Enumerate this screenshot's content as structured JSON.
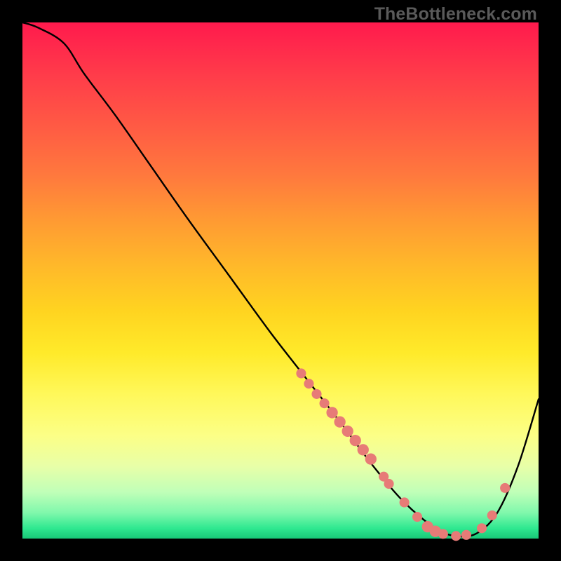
{
  "watermark": "TheBottleneck.com",
  "colors": {
    "background": "#000000",
    "curve": "#000000",
    "marker_fill": "#e77b77",
    "gradient_top": "#ff1a4d",
    "gradient_bottom": "#18c878"
  },
  "chart_data": {
    "type": "line",
    "title": "",
    "xlabel": "",
    "ylabel": "",
    "xlim": [
      0,
      100
    ],
    "ylim": [
      0,
      100
    ],
    "x": [
      0,
      3,
      8,
      12,
      18,
      25,
      32,
      40,
      48,
      55,
      62,
      68,
      74,
      80,
      84,
      88,
      92,
      96,
      100
    ],
    "values": [
      100,
      99,
      96,
      90,
      82,
      72,
      62,
      51,
      40,
      31,
      22,
      14,
      7,
      2,
      0.5,
      1,
      5,
      14,
      27
    ],
    "series": [
      {
        "name": "bottleneck-curve",
        "x": [
          0,
          3,
          8,
          12,
          18,
          25,
          32,
          40,
          48,
          55,
          62,
          68,
          74,
          80,
          84,
          88,
          92,
          96,
          100
        ],
        "y": [
          100,
          99,
          96,
          90,
          82,
          72,
          62,
          51,
          40,
          31,
          22,
          14,
          7,
          2,
          0.5,
          1,
          5,
          14,
          27
        ]
      }
    ],
    "markers": [
      {
        "x": 54,
        "y": 32.0,
        "r": 1.1
      },
      {
        "x": 55.5,
        "y": 30.0,
        "r": 1.1
      },
      {
        "x": 57,
        "y": 28.0,
        "r": 1.1
      },
      {
        "x": 58.5,
        "y": 26.2,
        "r": 1.1
      },
      {
        "x": 60,
        "y": 24.4,
        "r": 1.4
      },
      {
        "x": 61.5,
        "y": 22.6,
        "r": 1.4
      },
      {
        "x": 63,
        "y": 20.8,
        "r": 1.4
      },
      {
        "x": 64.5,
        "y": 19.0,
        "r": 1.4
      },
      {
        "x": 66,
        "y": 17.2,
        "r": 1.4
      },
      {
        "x": 67.5,
        "y": 15.4,
        "r": 1.4
      },
      {
        "x": 70,
        "y": 12.0,
        "r": 1.1
      },
      {
        "x": 71,
        "y": 10.6,
        "r": 1.1
      },
      {
        "x": 74,
        "y": 7.0,
        "r": 1.1
      },
      {
        "x": 76.5,
        "y": 4.2,
        "r": 1.1
      },
      {
        "x": 78.5,
        "y": 2.3,
        "r": 1.4
      },
      {
        "x": 80,
        "y": 1.4,
        "r": 1.4
      },
      {
        "x": 81.5,
        "y": 0.9,
        "r": 1.1
      },
      {
        "x": 84,
        "y": 0.5,
        "r": 1.1
      },
      {
        "x": 86,
        "y": 0.7,
        "r": 1.1
      },
      {
        "x": 89,
        "y": 2.0,
        "r": 1.1
      },
      {
        "x": 91,
        "y": 4.5,
        "r": 1.1
      },
      {
        "x": 93.5,
        "y": 9.8,
        "r": 1.1
      }
    ]
  }
}
